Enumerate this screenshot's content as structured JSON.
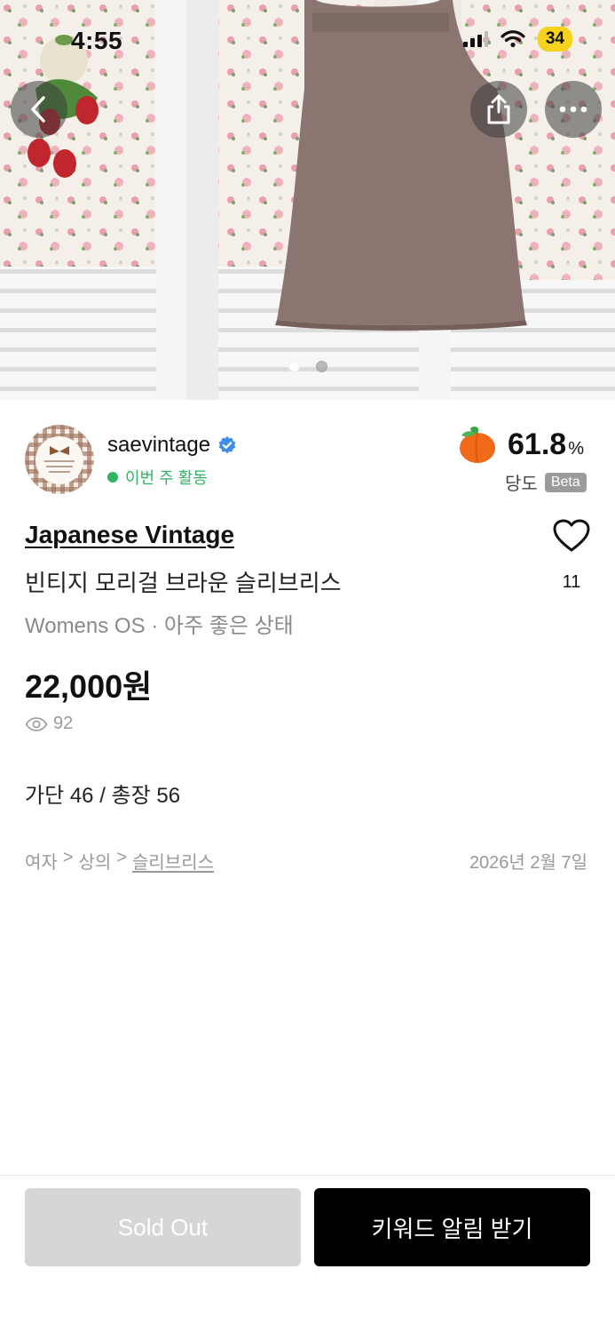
{
  "status_bar": {
    "time": "4:55",
    "battery": "34"
  },
  "hero": {
    "image_count": 2,
    "active_index": 0
  },
  "seller": {
    "name": "saevintage",
    "activity": "이번 주 활동",
    "peach_score": "61.8",
    "peach_unit": "%",
    "peach_label": "당도",
    "beta_badge": "Beta"
  },
  "product": {
    "brand": "Japanese Vintage",
    "title": "빈티지 모리걸 브라운 슬리브리스",
    "meta": "Womens OS · 아주 좋은 상태",
    "price": "22,000원",
    "views": "92",
    "likes": "11",
    "description": "가단 46 / 총장 56",
    "breadcrumb": {
      "level1": "여자",
      "sep1": ">",
      "level2": "상의",
      "sep2": ">",
      "level3": "슬리브리스"
    },
    "date": "2026년 2월 7일"
  },
  "actions": {
    "sold_out": "Sold Out",
    "keyword_alert": "키워드 알림 받기"
  },
  "colors": {
    "accent_green": "#2fb463",
    "verified_blue": "#3d8ee6",
    "peach": "#f06a1a",
    "soldout_bg": "#d6d6d6",
    "primary_btn": "#000000"
  }
}
